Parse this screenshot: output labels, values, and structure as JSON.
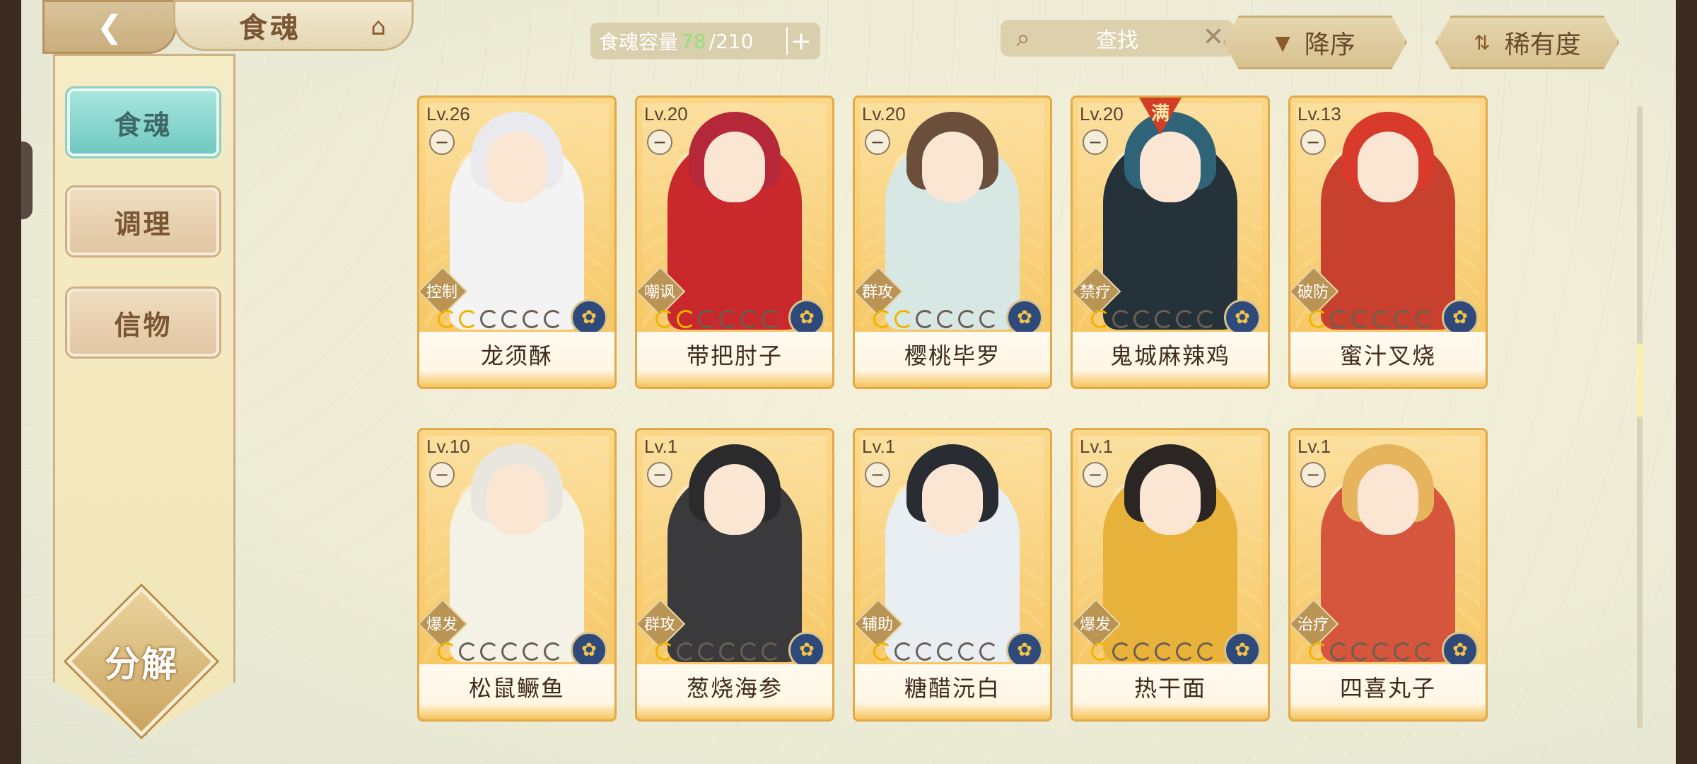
{
  "header": {
    "title": "食魂",
    "capacity_label": "食魂容量",
    "capacity_current": "78",
    "capacity_total": "/210",
    "search_placeholder": "查找",
    "sort_order_label": "降序",
    "sort_field_label": "稀有度"
  },
  "sidebar": {
    "tabs": [
      {
        "label": "食魂",
        "active": true
      },
      {
        "label": "调理",
        "active": false
      },
      {
        "label": "信物",
        "active": false
      }
    ],
    "dismantle_label": "分解"
  },
  "cards": [
    {
      "level": "Lv.26",
      "role": "控制",
      "stars": 2,
      "name": "龙须酥",
      "full": false,
      "hair": "#e9e9ee",
      "outfit": "#f3f3f3"
    },
    {
      "level": "Lv.20",
      "role": "嘲讽",
      "stars": 2,
      "name": "带把肘子",
      "full": false,
      "hair": "#b4283a",
      "outfit": "#c9282d"
    },
    {
      "level": "Lv.20",
      "role": "群攻",
      "stars": 2,
      "name": "樱桃毕罗",
      "full": false,
      "hair": "#6b4f3a",
      "outfit": "#d7e7e4"
    },
    {
      "level": "Lv.20",
      "role": "禁疗",
      "stars": 1,
      "name": "鬼城麻辣鸡",
      "full": true,
      "full_label": "满",
      "hair": "#2f6478",
      "outfit": "#26323a"
    },
    {
      "level": "Lv.13",
      "role": "破防",
      "stars": 1,
      "name": "蜜汁叉烧",
      "full": false,
      "hair": "#d83b2b",
      "outfit": "#c8402e"
    },
    {
      "level": "Lv.10",
      "role": "爆发",
      "stars": 1,
      "name": "松鼠鳜鱼",
      "full": false,
      "hair": "#e8e6df",
      "outfit": "#f4f1e6"
    },
    {
      "level": "Lv.1",
      "role": "群攻",
      "stars": 1,
      "name": "葱烧海参",
      "full": false,
      "hair": "#2b2b2e",
      "outfit": "#3a3a3d"
    },
    {
      "level": "Lv.1",
      "role": "辅助",
      "stars": 1,
      "name": "糖醋沅白",
      "full": false,
      "hair": "#2a2c33",
      "outfit": "#e9eef3"
    },
    {
      "level": "Lv.1",
      "role": "爆发",
      "stars": 1,
      "name": "热干面",
      "full": false,
      "hair": "#2b2623",
      "outfit": "#e8b23a"
    },
    {
      "level": "Lv.1",
      "role": "治疗",
      "stars": 1,
      "name": "四喜丸子",
      "full": false,
      "hair": "#e6b45c",
      "outfit": "#d5563c"
    }
  ],
  "colors": {
    "accent_teal": "#6fc8c0",
    "card_gold": "#f6c35c",
    "capacity_current": "#8fe07a"
  }
}
